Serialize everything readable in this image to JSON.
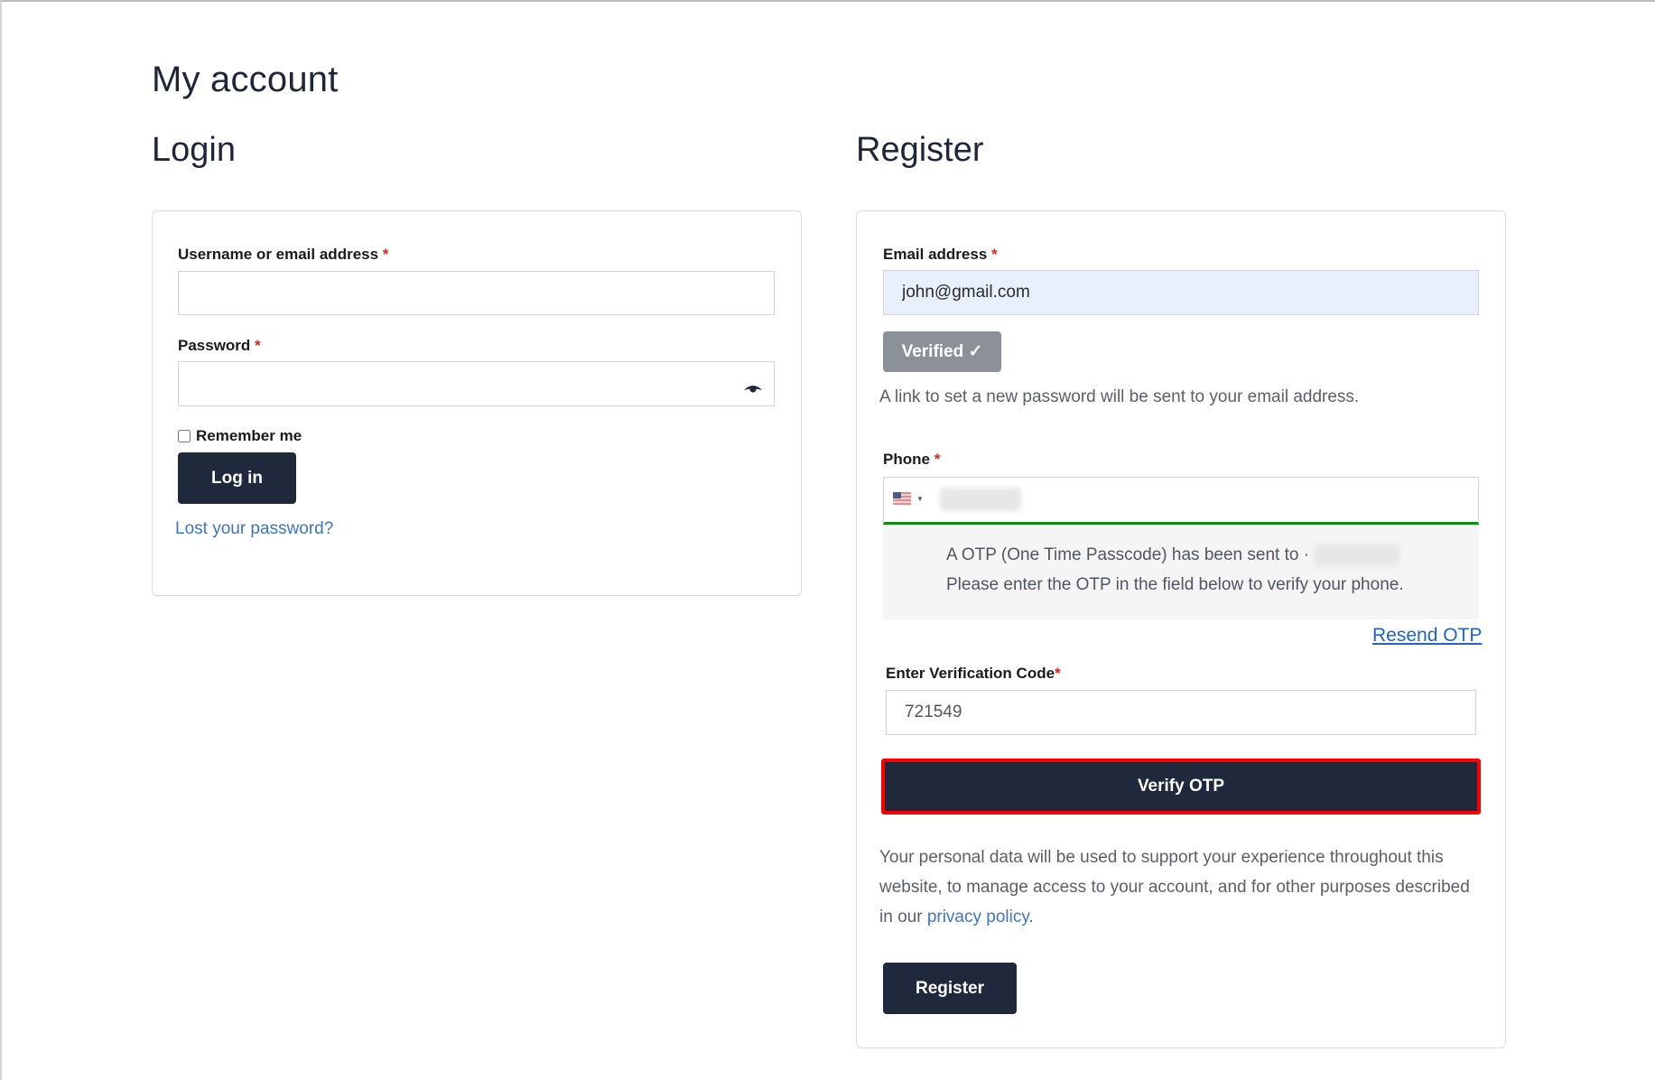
{
  "page": {
    "title": "My account"
  },
  "login": {
    "heading": "Login",
    "username_label": "Username or email address",
    "username_value": "",
    "password_label": "Password",
    "password_value": "",
    "required_mark": "*",
    "remember_label": "Remember me",
    "remember_checked": false,
    "login_button": "Log in",
    "lost_password_link": "Lost your password?"
  },
  "register": {
    "heading": "Register",
    "email_label": "Email address",
    "email_value": "john@gmail.com",
    "required_mark": "*",
    "verified_button": "Verified ✓",
    "password_note": "A link to set a new password will be sent to your email address.",
    "phone_label": "Phone",
    "phone_country": "US",
    "phone_value_hidden": true,
    "otp_message_line1": "A OTP (One Time Passcode) has been sent to",
    "otp_message_line2": "Please enter the OTP in the field below to verify your phone.",
    "resend_otp_link": "Resend OTP",
    "verification_label": "Enter Verification Code",
    "verification_value": "721549",
    "verify_otp_button": "Verify OTP",
    "privacy_text_before": "Your personal data will be used to support your experience throughout this website, to manage access to your account, and for other purposes described in our ",
    "privacy_link": "privacy policy",
    "privacy_text_after": ".",
    "register_button": "Register"
  },
  "colors": {
    "primary_dark": "#1f293b",
    "link": "#3b75c4",
    "required": "#e2231a",
    "phone_valid_underline": "#138a13",
    "highlight_outline": "#ff0000",
    "verified_gray": "#8c9199",
    "autofill_bg": "#e8f0fe"
  }
}
